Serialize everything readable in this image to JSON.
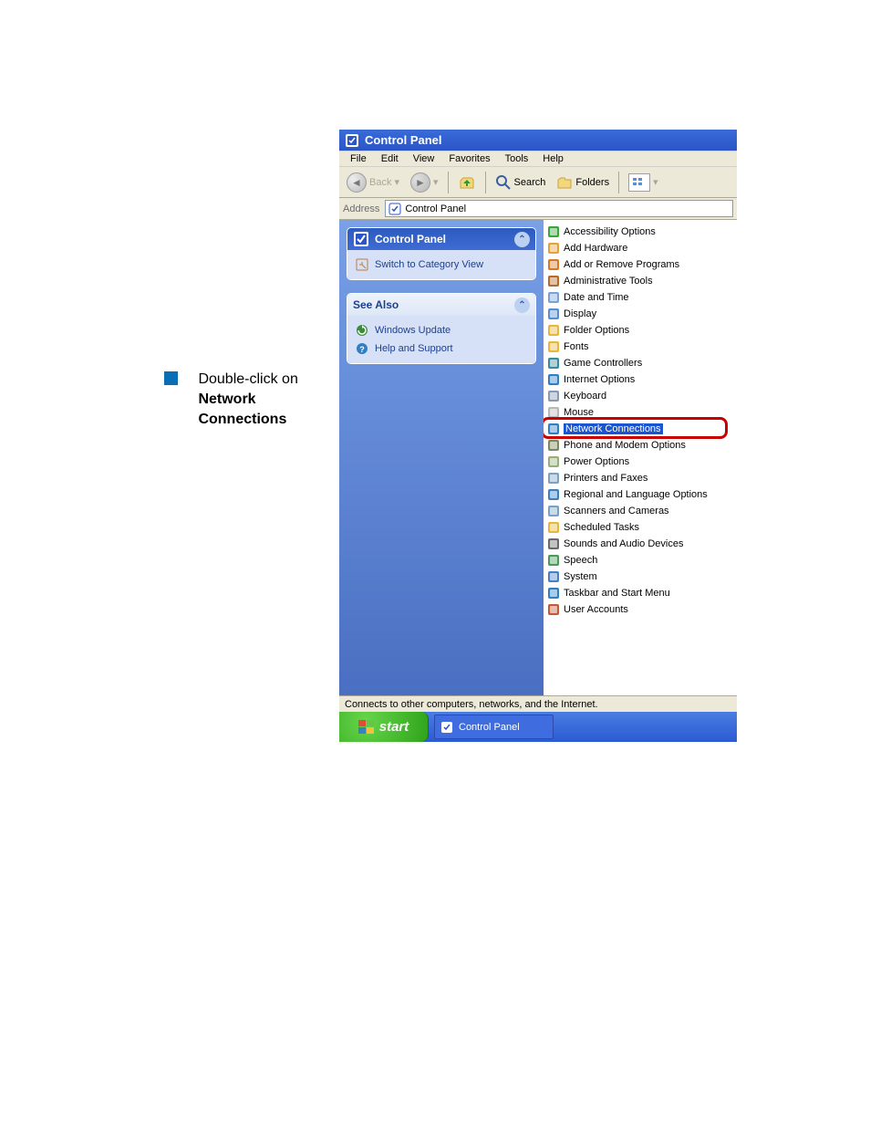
{
  "instruction": {
    "line1": "Double-click on",
    "line2": "Network",
    "line3": "Connections"
  },
  "window": {
    "title": "Control Panel",
    "menubar": [
      "File",
      "Edit",
      "View",
      "Favorites",
      "Tools",
      "Help"
    ],
    "toolbar": {
      "back": "Back",
      "search": "Search",
      "folders": "Folders"
    },
    "address": {
      "label": "Address",
      "value": "Control Panel"
    },
    "taskpane": {
      "header": "Control Panel",
      "switch": "Switch to Category View",
      "see_also": "See Also",
      "links": {
        "update": "Windows Update",
        "help": "Help and Support"
      }
    },
    "items": [
      {
        "label": "Accessibility Options",
        "icon": "accessibility",
        "color": "#3aa53a"
      },
      {
        "label": "Add Hardware",
        "icon": "add-hardware",
        "color": "#e4a33a"
      },
      {
        "label": "Add or Remove Programs",
        "icon": "add-remove",
        "color": "#d57a2d"
      },
      {
        "label": "Administrative Tools",
        "icon": "admin-tools",
        "color": "#b56a2a"
      },
      {
        "label": "Date and Time",
        "icon": "date-time",
        "color": "#7aa2d6"
      },
      {
        "label": "Display",
        "icon": "display",
        "color": "#5a8fcf"
      },
      {
        "label": "Folder Options",
        "icon": "folder-options",
        "color": "#e6b73a"
      },
      {
        "label": "Fonts",
        "icon": "fonts",
        "color": "#e6b73a"
      },
      {
        "label": "Game Controllers",
        "icon": "game",
        "color": "#3a8c9a"
      },
      {
        "label": "Internet Options",
        "icon": "internet",
        "color": "#2f7fc2"
      },
      {
        "label": "Keyboard",
        "icon": "keyboard",
        "color": "#8a9aaf"
      },
      {
        "label": "Mouse",
        "icon": "mouse",
        "color": "#b8b8b8"
      },
      {
        "label": "Network Connections",
        "icon": "network",
        "color": "#2f7fc2",
        "highlighted": true
      },
      {
        "label": "Phone and Modem Options",
        "icon": "phone",
        "color": "#7a8a5a"
      },
      {
        "label": "Power Options",
        "icon": "power",
        "color": "#9aae7a"
      },
      {
        "label": "Printers and Faxes",
        "icon": "printers",
        "color": "#7aa2c2"
      },
      {
        "label": "Regional and Language Options",
        "icon": "regional",
        "color": "#3a7fc2"
      },
      {
        "label": "Scanners and Cameras",
        "icon": "scanners",
        "color": "#7aa2c2"
      },
      {
        "label": "Scheduled Tasks",
        "icon": "scheduled",
        "color": "#e6b73a"
      },
      {
        "label": "Sounds and Audio Devices",
        "icon": "sounds",
        "color": "#6a6a6a"
      },
      {
        "label": "Speech",
        "icon": "speech",
        "color": "#4a9a5a"
      },
      {
        "label": "System",
        "icon": "system",
        "color": "#4a7fc2"
      },
      {
        "label": "Taskbar and Start Menu",
        "icon": "taskbar",
        "color": "#2f7fc2"
      },
      {
        "label": "User Accounts",
        "icon": "users",
        "color": "#c25a3a"
      }
    ],
    "statusbar": "Connects to other computers, networks, and the Internet.",
    "taskbar": {
      "start": "start",
      "app": "Control Panel"
    }
  }
}
